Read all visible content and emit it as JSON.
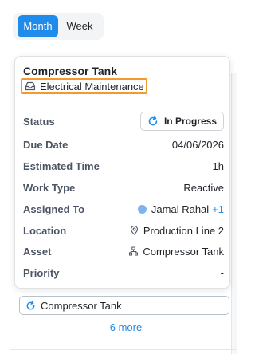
{
  "view_toggle": {
    "month_label": "Month",
    "week_label": "Week",
    "selected": "Month"
  },
  "popover": {
    "title": "Compressor Tank",
    "category": {
      "icon": "inbox-tray-icon",
      "label": "Electrical Maintenance"
    },
    "fields": {
      "status": {
        "label": "Status",
        "value": "In Progress",
        "icon": "refresh-icon"
      },
      "due_date": {
        "label": "Due Date",
        "value": "04/06/2026"
      },
      "estimated_time": {
        "label": "Estimated Time",
        "value": "1h"
      },
      "work_type": {
        "label": "Work Type",
        "value": "Reactive"
      },
      "assigned_to": {
        "label": "Assigned To",
        "value": "Jamal Rahal",
        "extra": "+1"
      },
      "location": {
        "label": "Location",
        "value": "Production Line 2",
        "icon": "map-pin-icon"
      },
      "asset": {
        "label": "Asset",
        "value": "Compressor Tank",
        "icon": "asset-tree-icon"
      },
      "priority": {
        "label": "Priority",
        "value": "-"
      }
    }
  },
  "calendar_event": {
    "label": "Compressor Tank",
    "icon": "refresh-icon"
  },
  "more_link": "6 more",
  "colors": {
    "accent": "#1f8ceb",
    "highlight_border": "#f29a2e",
    "avatar": "#7fb2ee"
  }
}
